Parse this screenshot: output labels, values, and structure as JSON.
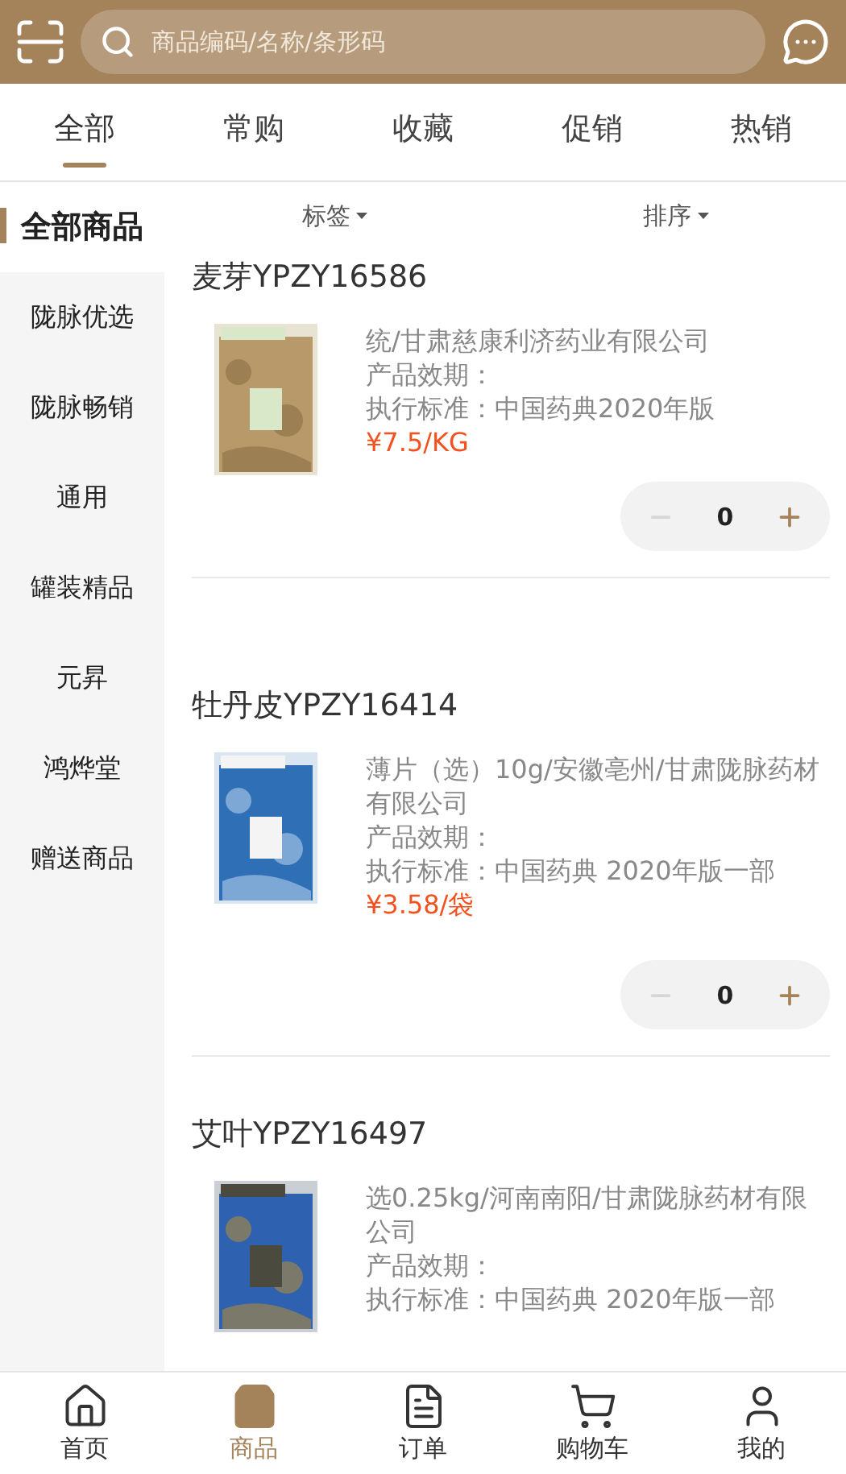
{
  "header": {
    "search": {
      "placeholder": "商品编码/名称/条形码"
    }
  },
  "tabs": [
    {
      "label": "全部",
      "selected": true
    },
    {
      "label": "常购",
      "selected": false
    },
    {
      "label": "收藏",
      "selected": false
    },
    {
      "label": "促销",
      "selected": false
    },
    {
      "label": "热销",
      "selected": false
    }
  ],
  "sidebar": {
    "items": [
      {
        "label": "全部商品",
        "selected": true
      },
      {
        "label": "陇脉优选",
        "selected": false
      },
      {
        "label": "陇脉畅销",
        "selected": false
      },
      {
        "label": "通用",
        "selected": false
      },
      {
        "label": "罐装精品",
        "selected": false
      },
      {
        "label": "元昇",
        "selected": false
      },
      {
        "label": "鸿烨堂",
        "selected": false
      },
      {
        "label": "赠送商品",
        "selected": false
      }
    ]
  },
  "filters": [
    "标签",
    "排序"
  ],
  "products": [
    {
      "name": "麦芽YPZY16586",
      "details": [
        "统/甘肃慈康利济药业有限公司",
        "产品效期：",
        "执行标准：中国药典2020年版"
      ],
      "price": "¥7.5/KG",
      "quantity": "0"
    },
    {
      "name": "牡丹皮YPZY16414",
      "details": [
        "薄片（选）10g/安徽亳州/甘肃陇脉药材有限公司",
        "产品效期：",
        "执行标准：中国药典 2020年版一部"
      ],
      "price": "¥3.58/袋",
      "quantity": "0"
    },
    {
      "name": "艾叶YPZY16497",
      "details": [
        "选0.25kg/河南南阳/甘肃陇脉药材有限公司",
        "产品效期：",
        "执行标准：中国药典 2020年版一部"
      ]
    }
  ],
  "bottom_nav": [
    {
      "label": "首页",
      "selected": false
    },
    {
      "label": "商品",
      "selected": true
    },
    {
      "label": "订单",
      "selected": false
    },
    {
      "label": "购物车",
      "selected": false
    },
    {
      "label": "我的",
      "selected": false
    }
  ]
}
